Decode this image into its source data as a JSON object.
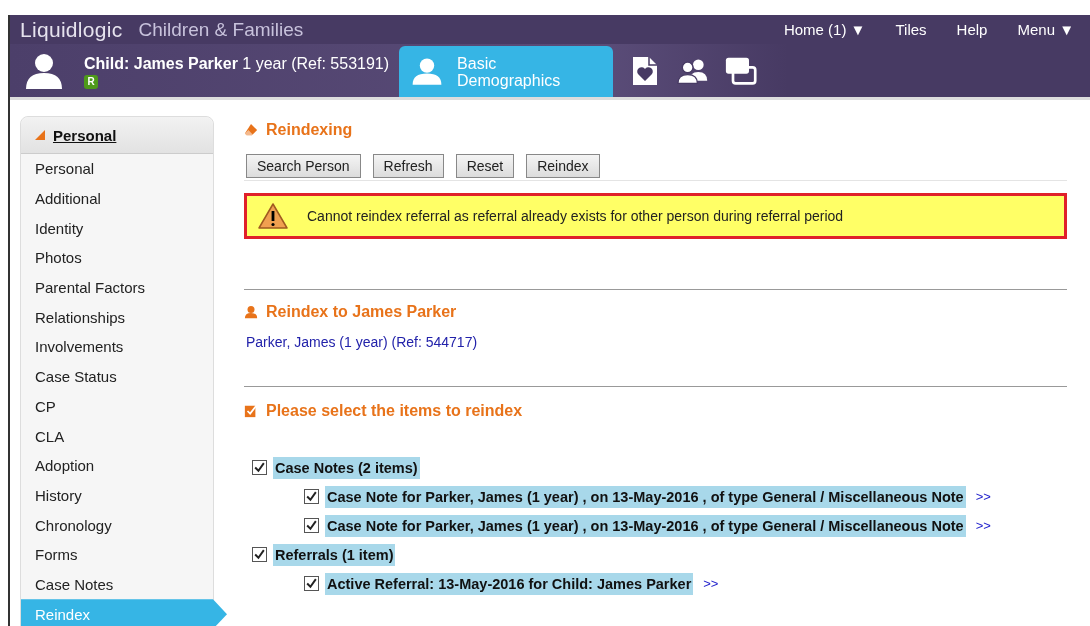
{
  "app": {
    "logo": "Liquidlogic",
    "title": "Children & Families"
  },
  "top_menu": [
    {
      "label": "Home (1) ▼"
    },
    {
      "label": "Tiles"
    },
    {
      "label": "Help"
    },
    {
      "label": "Menu ▼"
    }
  ],
  "person": {
    "title": "**Child: James Parker** 1 year (Ref: 553191)",
    "badge": "R"
  },
  "tabs": [
    {
      "kind": "person",
      "label": "Basic Demographics",
      "selected": true
    },
    {
      "kind": "document",
      "selected": false
    },
    {
      "kind": "people",
      "selected": false
    },
    {
      "kind": "windows",
      "selected": false
    }
  ],
  "sidebar": {
    "header": "Personal",
    "expanded": true,
    "items": [
      {
        "label": "Personal",
        "selected": false
      },
      {
        "label": "Additional",
        "selected": false
      },
      {
        "label": "Identity",
        "selected": false
      },
      {
        "label": "Photos",
        "selected": false
      },
      {
        "label": "Parental Factors",
        "selected": false
      },
      {
        "label": "Relationships",
        "selected": false
      },
      {
        "label": "Involvements",
        "selected": false
      },
      {
        "label": "Case Status",
        "selected": false
      },
      {
        "label": "CP",
        "selected": false
      },
      {
        "label": "CLA",
        "selected": false
      },
      {
        "label": "Adoption",
        "selected": false
      },
      {
        "label": "History",
        "selected": false
      },
      {
        "label": "Chronology",
        "selected": false
      },
      {
        "label": "Forms",
        "selected": false
      },
      {
        "label": "Case Notes",
        "selected": false
      },
      {
        "label": "Reindex",
        "selected": true
      }
    ]
  },
  "main": {
    "title": "Reindexing",
    "buttons": [
      "Search Person",
      "Refresh",
      "Reset",
      "Reindex"
    ],
    "warning": "Cannot reindex referral as referral already exists for other person during referral period",
    "target_heading": "Reindex to James Parker",
    "target_link": "Parker, James (1 year) (Ref: 544717)",
    "items_heading": "Please select the items to reindex",
    "tree": [
      {
        "label": "Case Notes (2 items)",
        "checked": true,
        "children": [
          {
            "label": "Case Note for Parker, James (1 year) , on 13-May-2016 , of type General / Miscellaneous Note",
            "checked": true,
            "link": ">>"
          },
          {
            "label": "Case Note for Parker, James (1 year) , on 13-May-2016 , of type General / Miscellaneous Note",
            "checked": true,
            "link": ">>"
          }
        ]
      },
      {
        "label": "Referrals (1 item)",
        "checked": true,
        "children": [
          {
            "label": "Active Referral: 13-May-2016 for Child: James Parker",
            "checked": true,
            "link": ">>"
          }
        ]
      }
    ]
  }
}
